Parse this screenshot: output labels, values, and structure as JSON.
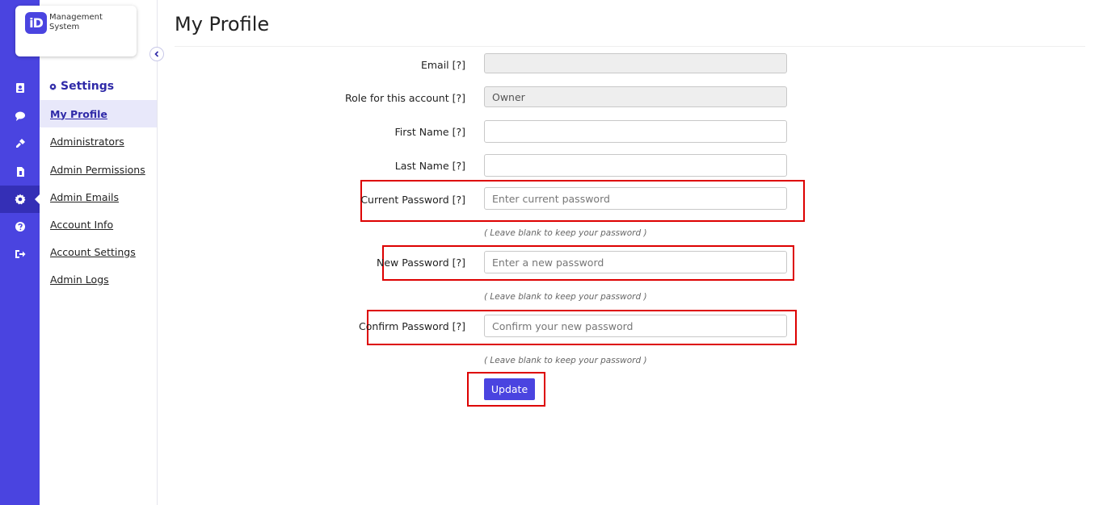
{
  "logo": {
    "badge": "iD",
    "text": "Management System"
  },
  "rail": {
    "items": [
      {
        "icon": "contacts-icon"
      },
      {
        "icon": "chat-icon"
      },
      {
        "icon": "plug-icon"
      },
      {
        "icon": "document-dollar-icon"
      },
      {
        "icon": "gear-icon",
        "active": true
      },
      {
        "icon": "help-icon"
      },
      {
        "icon": "sign-out-icon"
      }
    ]
  },
  "sidebar": {
    "heading": "Settings",
    "items": [
      {
        "label": "My Profile",
        "active": true
      },
      {
        "label": "Administrators"
      },
      {
        "label": "Admin Permissions"
      },
      {
        "label": "Admin Emails"
      },
      {
        "label": "Account Info"
      },
      {
        "label": "Account Settings"
      },
      {
        "label": "Admin Logs"
      }
    ]
  },
  "page": {
    "title": "My Profile"
  },
  "form": {
    "email": {
      "label": "Email [?]",
      "value": ""
    },
    "role": {
      "label": "Role for this account [?]",
      "value": "Owner"
    },
    "first_name": {
      "label": "First Name [?]",
      "value": ""
    },
    "last_name": {
      "label": "Last Name [?]",
      "value": ""
    },
    "current_password": {
      "label": "Current Password [?]",
      "placeholder": "Enter current password"
    },
    "new_password": {
      "label": "New Password [?]",
      "placeholder": "Enter a new password"
    },
    "confirm_password": {
      "label": "Confirm Password [?]",
      "placeholder": "Confirm your new password"
    },
    "hint": "( Leave blank to keep your password )",
    "submit_label": "Update"
  },
  "colors": {
    "accent": "#4a44e0",
    "highlight": "#dd0000",
    "rail_active": "#342fb6"
  }
}
